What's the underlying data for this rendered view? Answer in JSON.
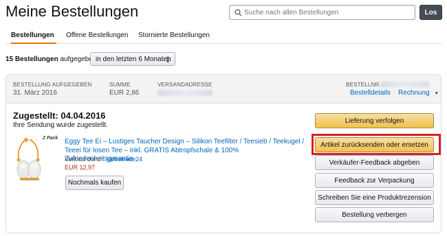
{
  "page": {
    "title": "Meine Bestellungen"
  },
  "search": {
    "placeholder": "Suche nach allen Bestellungen",
    "button_label": "Los"
  },
  "tabs": [
    {
      "label": "Bestellungen",
      "active": true
    },
    {
      "label": "Offene Bestellungen",
      "active": false
    },
    {
      "label": "Stornierte Bestellungen",
      "active": false
    }
  ],
  "filter": {
    "count_bold": "15 Bestellungen",
    "count_rest": "aufgegeben",
    "period_selected": "in den letzten 6 Monaten"
  },
  "order": {
    "header": {
      "placed_label": "BESTELLUNG AUFGEGEBEN",
      "placed_value": "31. März 2016",
      "total_label": "SUMME",
      "total_value": "EUR 2,86",
      "address_label": "VERSANDADRESSE",
      "order_no_label": "BESTELLNR.",
      "details_link": "Bestelldetails",
      "invoice_link": "Rechnung"
    },
    "status_title": "Zugestellt: 04.04.2016",
    "status_text": "Ihre Sendung wurde zugestellt.",
    "item": {
      "pack_label": "2 Pack",
      "title": "Eggy Tee Ei – Lustiges Taucher Design – Silikon Teefilter / Teesieb / Teekugel / Teeei für losen Tee – inkl. GRATIS Abtropfschale & 100% Zufriedenheitsgarantie",
      "sold_by_label": "Verkauf durch:",
      "seller": "globetrade24",
      "price": "EUR 12,97",
      "rebuy_label": "Nochmals kaufen"
    },
    "actions": [
      "Lieferung verfolgen",
      "Artikel zurücksenden oder ersetzen",
      "Verkäufer-Feedback abgeben",
      "Feedback zur Verpackung",
      "Schreiben Sie eine Produktrezension",
      "Bestellung verbergen"
    ]
  },
  "colors": {
    "accent_tab": "#e77600",
    "link": "#0066c0",
    "price": "#b12704",
    "primary_button": "#f0c14b",
    "highlight": "#d61f26"
  },
  "icons": {
    "search": "search-icon",
    "dropdown": "chevron-down-icon",
    "invoice_dropdown": "caret-down-icon"
  }
}
